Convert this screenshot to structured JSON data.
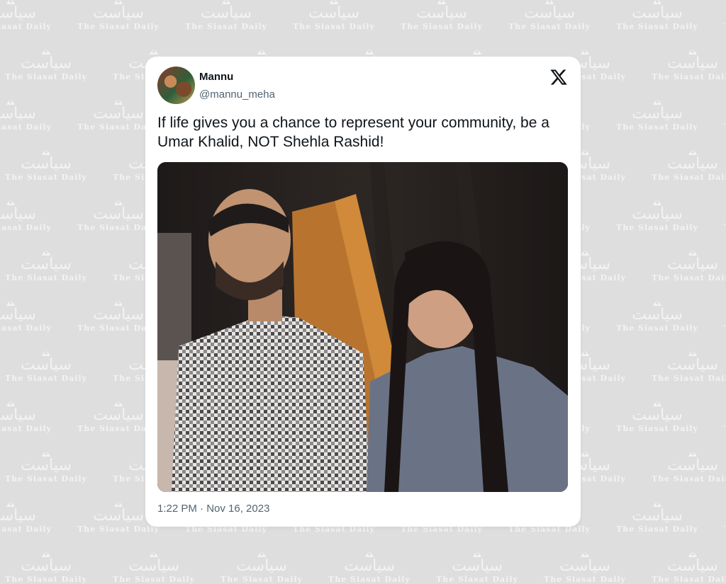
{
  "watermark": {
    "urdu": "سیاست",
    "latin": "The Siasat Daily"
  },
  "tweet": {
    "author_name": "Mannu",
    "author_handle": "@mannu_meha",
    "text": "If life gives you a chance to represent your community, be a Umar Khalid, NOT Shehla Rashid!",
    "timestamp": "1:22 PM · Nov 16, 2023",
    "platform_icon": "x-logo-icon"
  },
  "colors": {
    "background": "#dedede",
    "card": "#ffffff",
    "text_primary": "#0f1419",
    "text_secondary": "#536471"
  }
}
